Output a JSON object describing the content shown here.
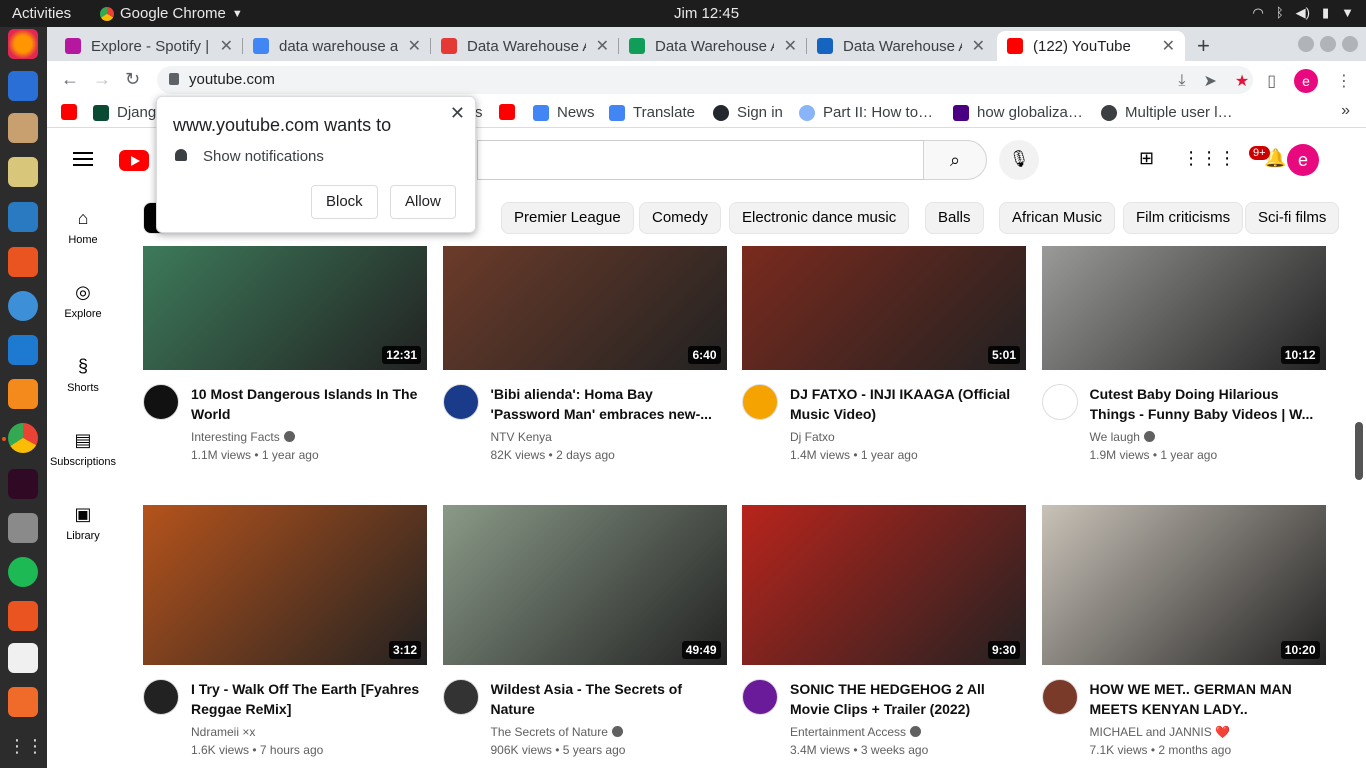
{
  "topbar": {
    "activities": "Activities",
    "app_name": "Google Chrome",
    "clock": "Jim 12:45"
  },
  "tabs": [
    {
      "title": "Explore - Spotify |",
      "color": "#b5179e"
    },
    {
      "title": "data warehouse a",
      "color": "#4285f4"
    },
    {
      "title": "Data Warehouse A",
      "color": "#e53935"
    },
    {
      "title": "Data Warehouse A",
      "color": "#0f9d58"
    },
    {
      "title": "Data Warehouse A",
      "color": "#1565c0"
    },
    {
      "title": "(122) YouTube",
      "color": "#ff0000"
    }
  ],
  "omnibox": {
    "url": "youtube.com"
  },
  "bookmarks": [
    {
      "label": "Djang",
      "color": "#0c4b33"
    },
    {
      "label": "s",
      "color": "#ffffff"
    },
    {
      "label": "",
      "color": "#ff0000"
    },
    {
      "label": "News",
      "color": "#4285f4"
    },
    {
      "label": "Translate",
      "color": "#4285f4"
    },
    {
      "label": "Sign in",
      "color": "#24292f"
    },
    {
      "label": "Part II: How to…",
      "color": "#8ab4f8"
    },
    {
      "label": "how globaliza…",
      "color": "#4b0082"
    },
    {
      "label": "Multiple user l…",
      "color": "#3c4043"
    }
  ],
  "permission": {
    "title": "www.youtube.com wants to",
    "desc": "Show notifications",
    "block": "Block",
    "allow": "Allow"
  },
  "youtube": {
    "notif_count": "9+",
    "avatar_letter": "e",
    "guide": [
      {
        "label": "Home",
        "icon": "home-icon"
      },
      {
        "label": "Explore",
        "icon": "compass-icon"
      },
      {
        "label": "Shorts",
        "icon": "shorts-icon"
      },
      {
        "label": "Subscriptions",
        "icon": "subscriptions-icon"
      },
      {
        "label": "Library",
        "icon": "library-icon"
      }
    ],
    "chips": [
      "Premier League",
      "Comedy",
      "Electronic dance music",
      "Balls",
      "African Music",
      "Film criticisms",
      "Sci-fi films"
    ],
    "videos": [
      {
        "title": "10 Most Dangerous Islands In The World",
        "channel": "Interesting Facts",
        "verified": true,
        "views": "1.1M views",
        "age": "1 year ago",
        "duration": "12:31",
        "thumb": "#3d7a5a",
        "avatar": "#111111"
      },
      {
        "title": "'Bibi alienda': Homa Bay 'Password Man' embraces new-...",
        "channel": "NTV Kenya",
        "verified": false,
        "views": "82K views",
        "age": "2 days ago",
        "duration": "6:40",
        "thumb": "#6b3b2a",
        "avatar": "#1a3a8a"
      },
      {
        "title": "DJ FATXO - INJI IKAAGA (Official Music Video)",
        "channel": "Dj Fatxo",
        "verified": false,
        "views": "1.4M views",
        "age": "1 year ago",
        "duration": "5:01",
        "thumb": "#7a2a1e",
        "avatar": "#f4a300"
      },
      {
        "title": "Cutest Baby Doing Hilarious Things - Funny Baby Videos | W...",
        "channel": "We laugh",
        "verified": true,
        "views": "1.9M views",
        "age": "1 year ago",
        "duration": "10:12",
        "thumb": "#9a9a98",
        "avatar": "#ffffff"
      },
      {
        "title": "I Try - Walk Off The Earth [Fyahres Reggae ReMix]",
        "channel": "Ndrameii ×x",
        "verified": false,
        "views": "1.6K views",
        "age": "7 hours ago",
        "duration": "3:12",
        "thumb": "#b5531c",
        "avatar": "#222222"
      },
      {
        "title": "Wildest Asia - The Secrets of Nature",
        "channel": "The Secrets of Nature",
        "verified": true,
        "views": "906K views",
        "age": "5 years ago",
        "duration": "49:49",
        "thumb": "#8a9a88",
        "avatar": "#333333"
      },
      {
        "title": "SONIC THE HEDGEHOG 2 All Movie Clips + Trailer (2022)",
        "channel": "Entertainment Access",
        "verified": true,
        "views": "3.4M views",
        "age": "3 weeks ago",
        "duration": "9:30",
        "thumb": "#b8241c",
        "avatar": "#6a1b9a"
      },
      {
        "title": "HOW WE MET.. GERMAN MAN MEETS KENYAN LADY..",
        "channel": "MICHAEL and JANNIS ❤️",
        "verified": false,
        "views": "7.1K views",
        "age": "2 months ago",
        "duration": "10:20",
        "thumb": "#c9c2b8",
        "avatar": "#7a3a2a"
      }
    ]
  }
}
